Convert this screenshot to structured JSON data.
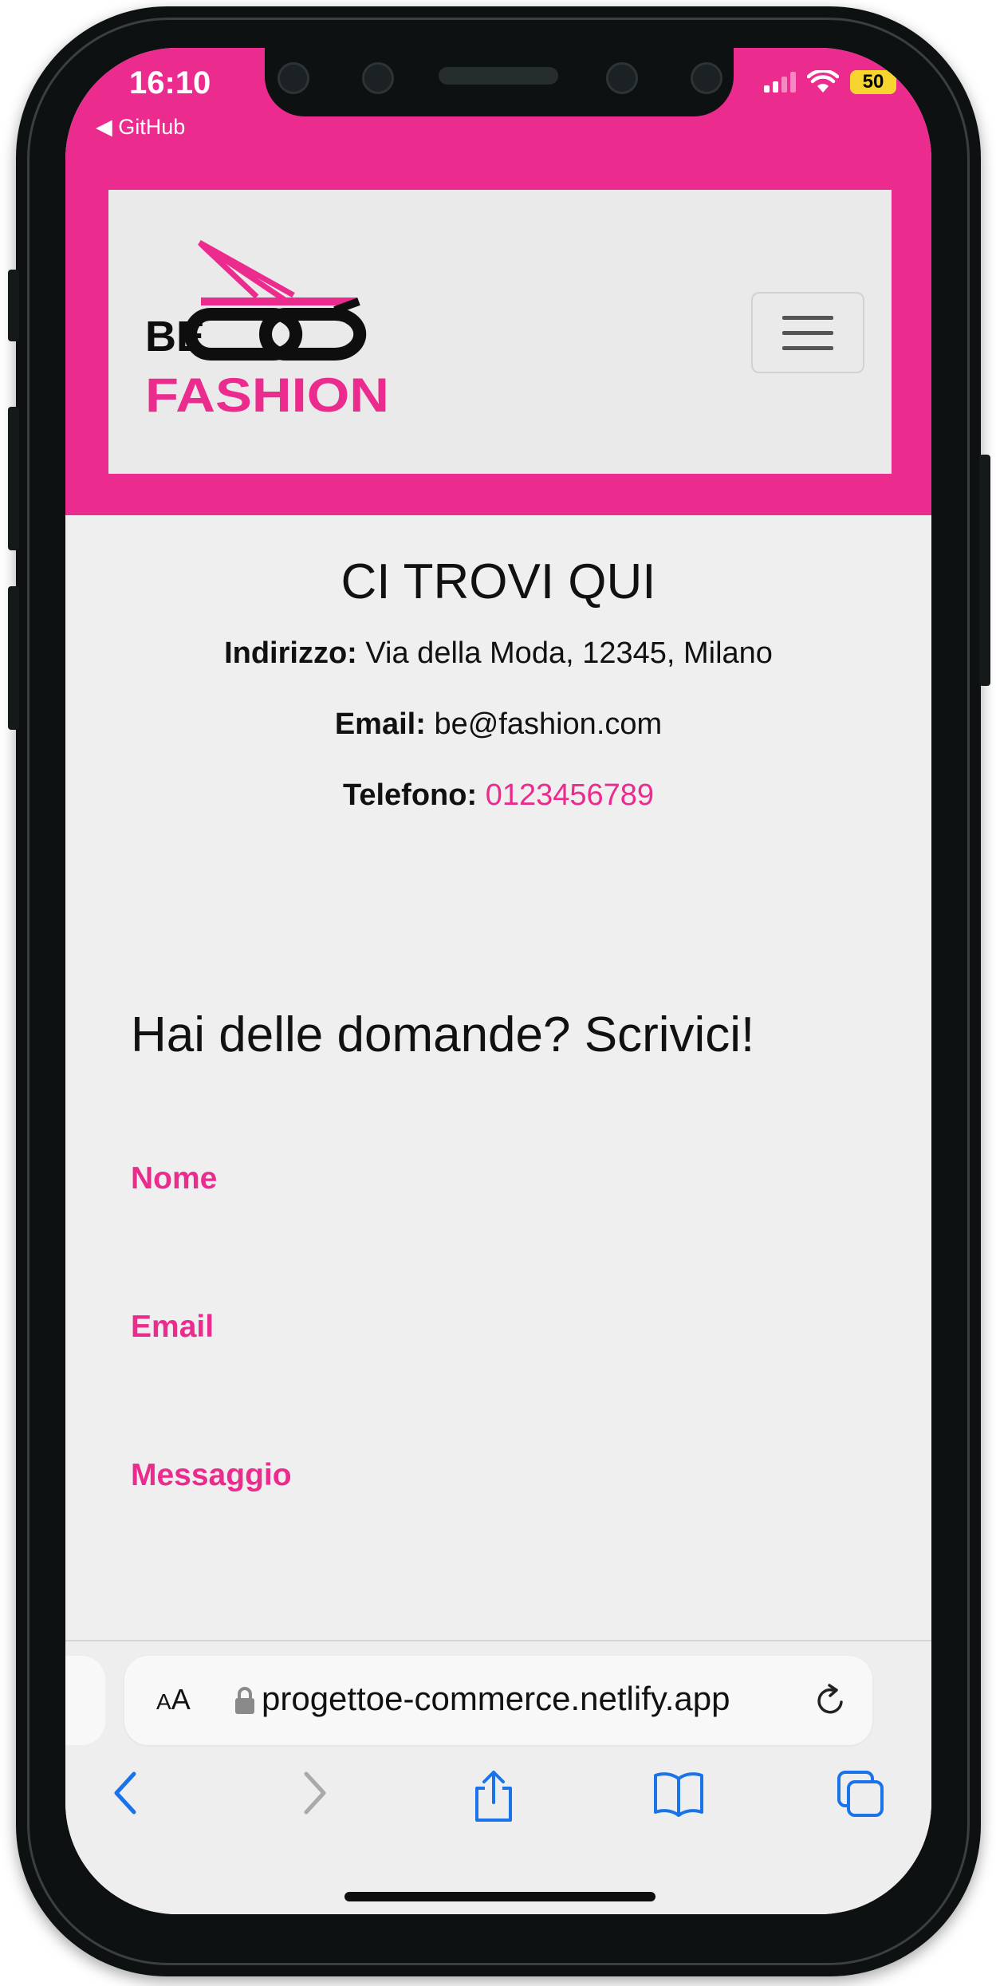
{
  "status_bar": {
    "time": "16:10",
    "back_app": "◀ GitHub",
    "battery": "50"
  },
  "brand": {
    "logo_top": "BE",
    "logo_bottom": "FASHION",
    "accent": "#ec2b8e"
  },
  "contact": {
    "title": "CI TROVI QUI",
    "address_label": "Indirizzo:",
    "address_value": "Via della Moda, 12345, Milano",
    "email_label": "Email:",
    "email_value": "be@fashion.com",
    "phone_label": "Telefono:",
    "phone_value": "0123456789"
  },
  "form": {
    "title": "Hai delle domande? Scrivici!",
    "name_label": "Nome",
    "email_label": "Email",
    "message_label": "Messaggio"
  },
  "safari": {
    "text_size_small": "A",
    "text_size_large": "A",
    "url": "progettoe-commerce.netlify.app"
  }
}
